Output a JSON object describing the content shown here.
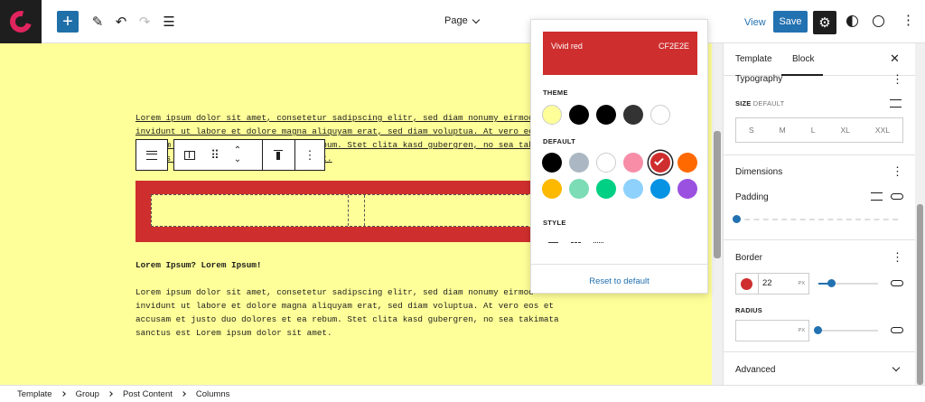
{
  "toolbar": {
    "page_label": "Page",
    "view_label": "View",
    "save_label": "Save"
  },
  "canvas": {
    "para1": [
      "Lorem ipsum dolor sit amet, consetetur sadipscing elitr, sed diam nonumy eirmod",
      "invidunt ut labore et dolore magna aliquyam erat, sed diam voluptua. At vero eos",
      "accusam et justo duo dolores et ea rebum. Stet clita kasd gubergren, no sea takimata",
      "sanctus est Lorem ipsum dolor sit amet."
    ],
    "heading": "Lorem Ipsum? Lorem Ipsum!",
    "para2": [
      "Lorem ipsum dolor sit amet, consetetur sadipscing elitr, sed diam nonumy eirmod",
      "invidunt ut labore et dolore magna aliquyam erat, sed diam voluptua. At vero eos et",
      "accusam et justo duo dolores et ea rebum. Stet clita kasd gubergren, no sea takimata",
      "sanctus est Lorem ipsum dolor sit amet."
    ]
  },
  "popover": {
    "selected_name": "Vivid red",
    "selected_hex": "CF2E2E",
    "theme_label": "THEME",
    "default_label": "DEFAULT",
    "style_label": "STYLE",
    "reset_label": "Reset to default",
    "theme_colors": [
      "#ffff99",
      "#000000",
      "#000000",
      "#333333",
      "#ffffff"
    ],
    "default_colors": [
      "#000000",
      "#abb8c3",
      "#ffffff",
      "#f78da7",
      "#cf2e2e",
      "#ff6900",
      "#fcb900",
      "#7bdcb5",
      "#00d084",
      "#8ed1fc",
      "#0693e3",
      "#9b51e0"
    ]
  },
  "sidebar": {
    "tab_template": "Template",
    "tab_block": "Block",
    "typography_title": "Typography",
    "size_label": "SIZE",
    "size_value": "DEFAULT",
    "sizes": [
      "S",
      "M",
      "L",
      "XL",
      "XXL"
    ],
    "dimensions_title": "Dimensions",
    "padding_label": "Padding",
    "border_title": "Border",
    "border_width": "22",
    "border_unit": "PX",
    "radius_label": "RADIUS",
    "radius_unit": "PX",
    "advanced_title": "Advanced"
  },
  "breadcrumb": [
    "Template",
    "Group",
    "Post Content",
    "Columns"
  ]
}
